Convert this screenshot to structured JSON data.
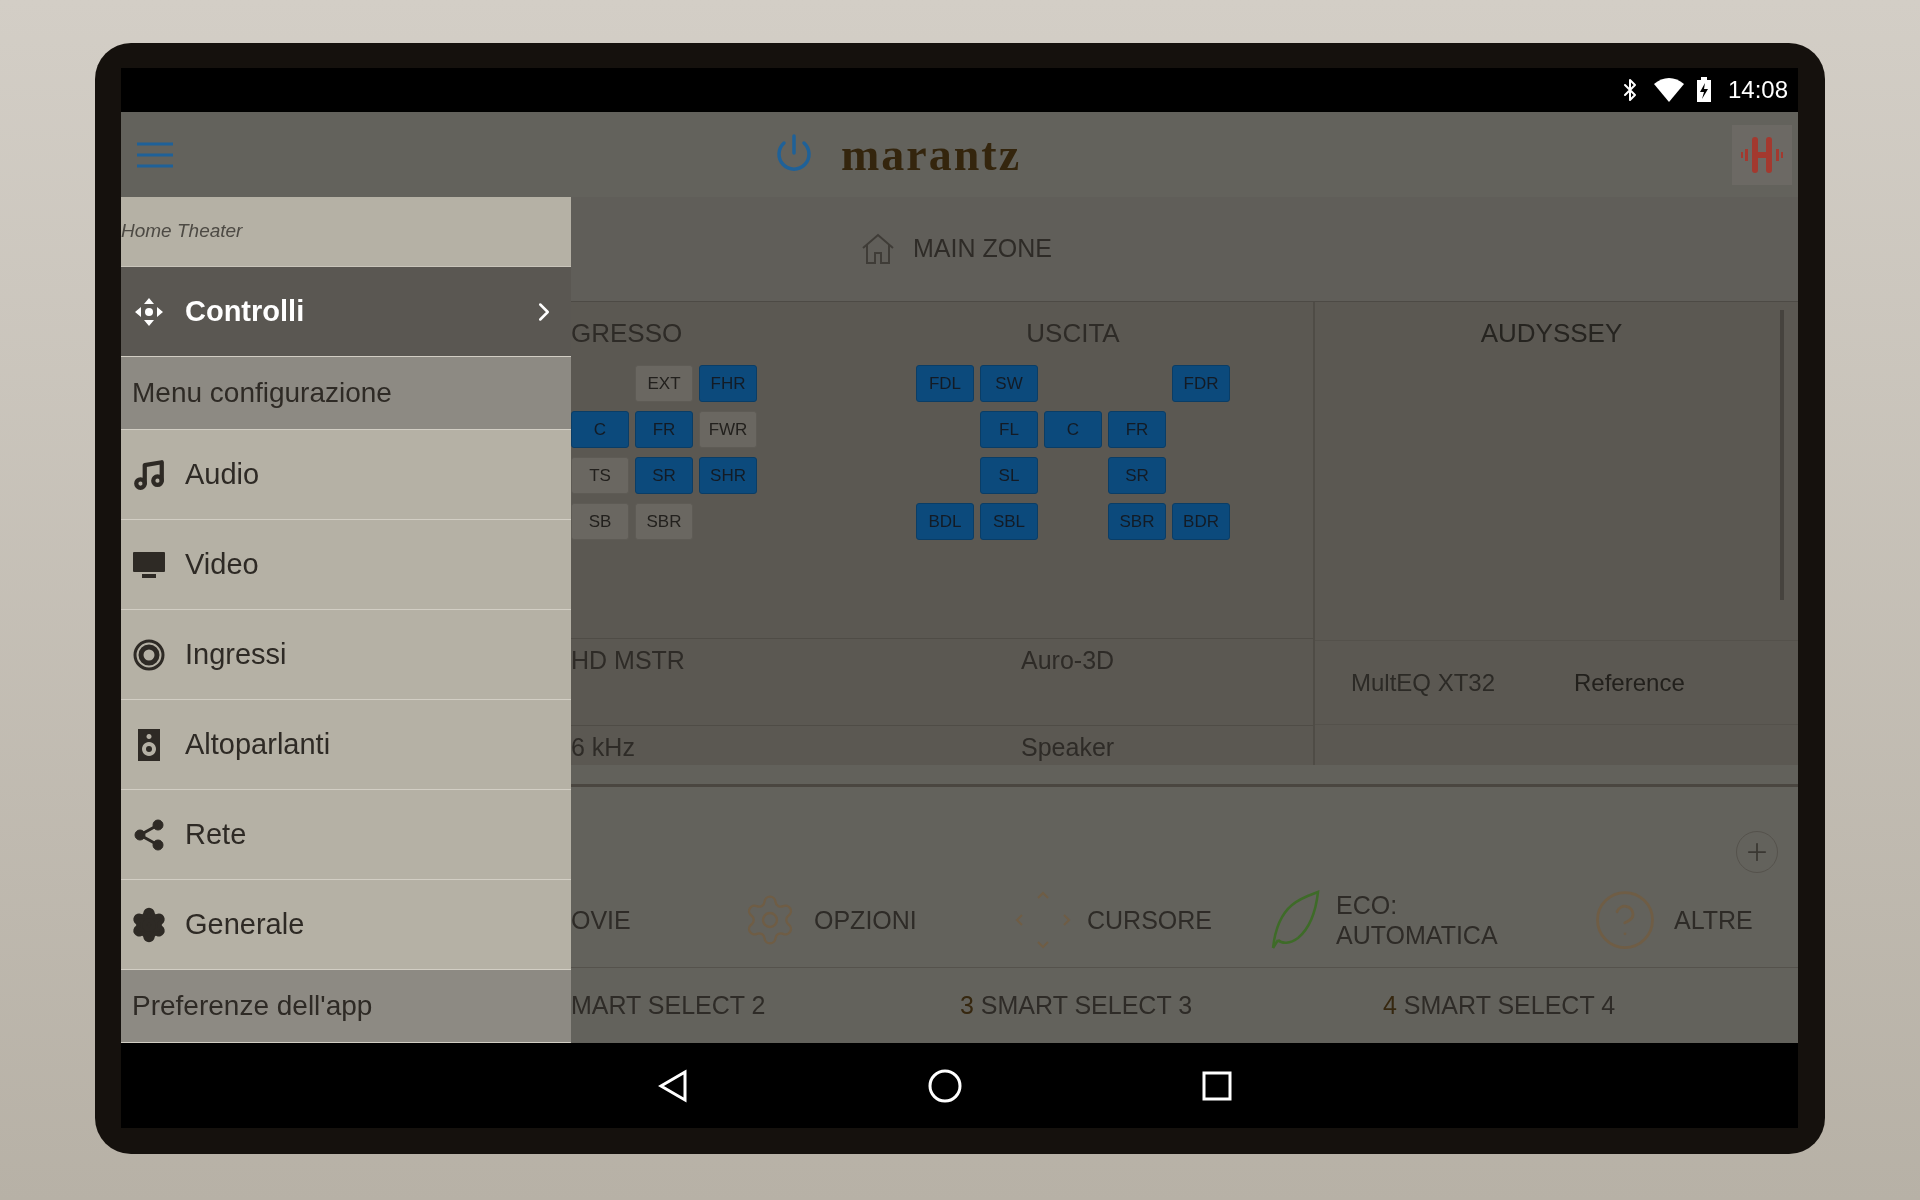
{
  "status_bar": {
    "time": "14:08"
  },
  "header": {
    "logo": "marantz"
  },
  "zone": {
    "label": "MAIN ZONE"
  },
  "drawer": {
    "title": "Home Theater",
    "items": [
      {
        "kind": "entry",
        "label": "Controlli",
        "selected": true
      },
      {
        "kind": "section",
        "label": "Menu configurazione",
        "selected": false
      },
      {
        "kind": "entry",
        "label": "Audio",
        "selected": false
      },
      {
        "kind": "entry",
        "label": "Video",
        "selected": false
      },
      {
        "kind": "entry",
        "label": "Ingressi",
        "selected": false
      },
      {
        "kind": "entry",
        "label": "Altoparlanti",
        "selected": false
      },
      {
        "kind": "entry",
        "label": "Rete",
        "selected": false
      },
      {
        "kind": "entry",
        "label": "Generale",
        "selected": false
      },
      {
        "kind": "section",
        "label": "Preferenze dell'app",
        "selected": false
      }
    ]
  },
  "input": {
    "title": "GRESSO",
    "speakers": [
      [
        {
          "kind": "empty"
        },
        {
          "label": "EXT",
          "active": false
        },
        {
          "label": "FHR",
          "active": true
        }
      ],
      [
        {
          "label": "C",
          "active": true
        },
        {
          "label": "FR",
          "active": true
        },
        {
          "label": "FWR",
          "active": false
        }
      ],
      [
        {
          "label": "TS",
          "active": false
        },
        {
          "label": "SR",
          "active": true
        },
        {
          "label": "SHR",
          "active": true
        }
      ],
      [
        {
          "label": "SB",
          "active": false
        },
        {
          "label": "SBR",
          "active": false
        },
        {
          "kind": "empty"
        }
      ]
    ]
  },
  "output": {
    "title": "USCITA",
    "speakers": [
      [
        {
          "label": "FDL",
          "active": true
        },
        {
          "label": "SW",
          "active": true
        },
        {
          "kind": "empty"
        },
        {
          "kind": "empty"
        },
        {
          "label": "FDR",
          "active": true
        }
      ],
      [
        {
          "kind": "empty"
        },
        {
          "label": "FL",
          "active": true
        },
        {
          "label": "C",
          "active": true
        },
        {
          "label": "FR",
          "active": true
        },
        {
          "kind": "empty"
        }
      ],
      [
        {
          "kind": "empty"
        },
        {
          "label": "SL",
          "active": true
        },
        {
          "kind": "empty"
        },
        {
          "label": "SR",
          "active": true
        },
        {
          "kind": "empty"
        }
      ],
      [
        {
          "label": "BDL",
          "active": true
        },
        {
          "label": "SBL",
          "active": true
        },
        {
          "kind": "empty"
        },
        {
          "label": "SBR",
          "active": true
        },
        {
          "label": "BDR",
          "active": true
        }
      ]
    ]
  },
  "signal_rows": [
    {
      "input": "HD MSTR",
      "output": "Auro-3D"
    },
    {
      "input": "6 kHz",
      "output": "Speaker"
    }
  ],
  "audyssey": {
    "title": "AUDYSSEY",
    "rows": [
      {
        "label": "MultEQ XT32",
        "value": "Reference"
      }
    ]
  },
  "quick_actions": [
    {
      "label": "OVIE"
    },
    {
      "label": "OPZIONI"
    },
    {
      "label": "CURSORE"
    },
    {
      "label": "ECO:\nAUTOMATICA"
    },
    {
      "label": "ALTRE"
    }
  ],
  "smart_selects": [
    {
      "label": "MART SELECT 2"
    },
    {
      "number": "3",
      "label": "SMART SELECT 3"
    },
    {
      "number": "4",
      "label": "SMART SELECT 4"
    }
  ]
}
